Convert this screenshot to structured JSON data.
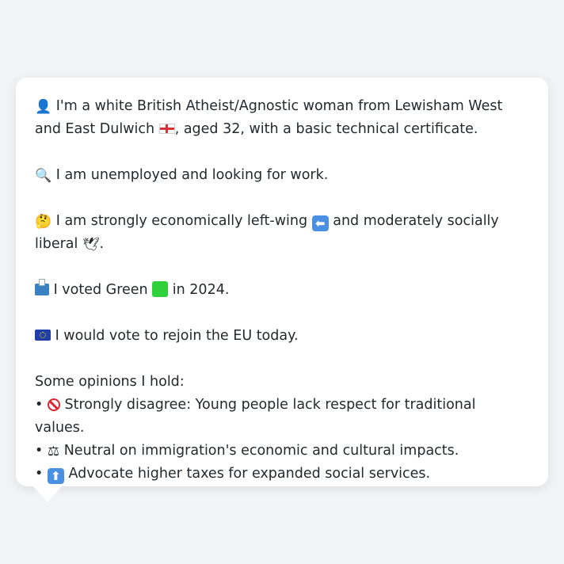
{
  "profile": {
    "intro": {
      "part1": " I'm a white British Atheist/Agnostic woman from Lewisham West and East Dulwich ",
      "part2": ", aged 32, with a basic technical certificate."
    },
    "employment": " I am unemployed and looking for work.",
    "politics": {
      "part1": " I am strongly economically left-wing ",
      "part2": " and moderately socially liberal ",
      "part3": "."
    },
    "vote": {
      "part1": " I voted Green ",
      "part2": " in 2024."
    },
    "eu": " I would vote to rejoin the EU today.",
    "opinions_heading": "Some opinions I hold:",
    "bullet": "•",
    "opinions": [
      " Strongly disagree: Young people lack respect for traditional values.",
      " Neutral on immigration's economic and cultural impacts.",
      " Advocate higher taxes for expanded social services."
    ]
  },
  "icons": {
    "person": "bust-in-silhouette-icon",
    "england_flag": "england-flag-icon",
    "magnifier": "magnifying-glass-icon",
    "thinking": "thinking-face-icon",
    "left_arrow": "left-arrow-icon",
    "dove": "dove-icon",
    "ballot": "ballot-box-icon",
    "green_square": "green-square-icon",
    "eu_flag": "eu-flag-icon",
    "prohibited": "prohibited-icon",
    "scales": "balance-scale-icon",
    "up_arrow": "up-arrow-icon"
  },
  "colors": {
    "background": "#f2f3f5",
    "card": "#ffffff",
    "text": "#24292e"
  }
}
